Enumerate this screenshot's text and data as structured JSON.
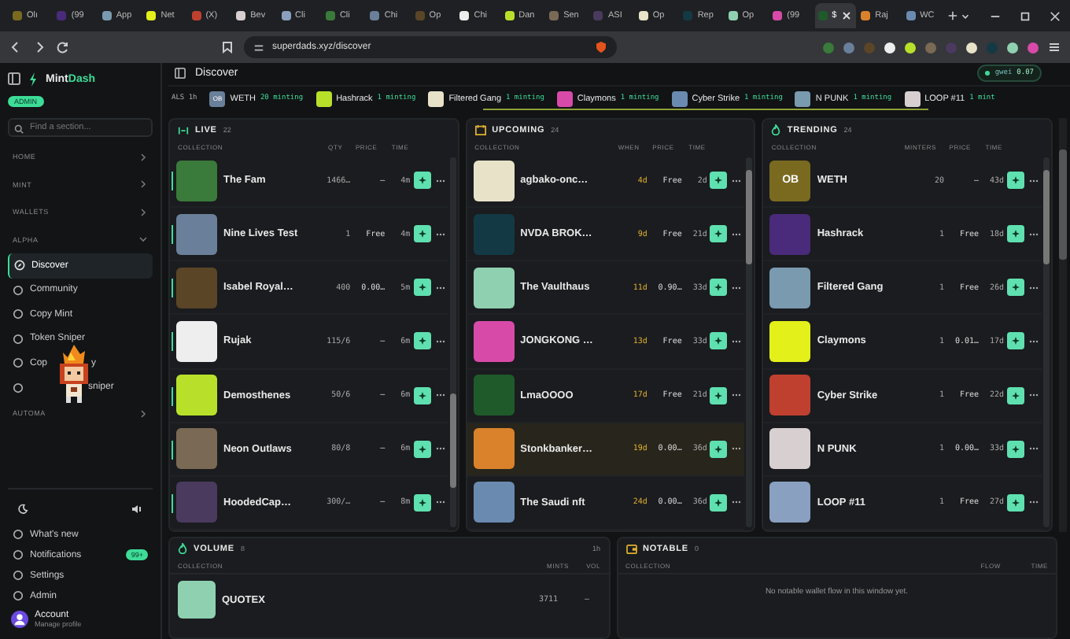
{
  "browser": {
    "tabs": [
      {
        "label": "Olı",
        "selected": false
      },
      {
        "label": "(99",
        "selected": false
      },
      {
        "label": "App",
        "selected": false
      },
      {
        "label": "Net",
        "selected": false
      },
      {
        "label": "(X)",
        "selected": false
      },
      {
        "label": "Bev",
        "selected": false
      },
      {
        "label": "Cli",
        "selected": false
      },
      {
        "label": "Cli",
        "selected": false
      },
      {
        "label": "Chi",
        "selected": false
      },
      {
        "label": "Op",
        "selected": false
      },
      {
        "label": "Chi",
        "selected": false
      },
      {
        "label": "Dan",
        "selected": false
      },
      {
        "label": "Sen",
        "selected": false
      },
      {
        "label": "ASI",
        "selected": false
      },
      {
        "label": "Op",
        "selected": false
      },
      {
        "label": "Rep",
        "selected": false
      },
      {
        "label": "Op",
        "selected": false
      },
      {
        "label": "(99",
        "selected": false
      },
      {
        "label": "$",
        "selected": true
      },
      {
        "label": "Raj",
        "selected": false
      },
      {
        "label": "WC",
        "selected": false
      }
    ],
    "address": "superdads.xyz/discover"
  },
  "sidebar": {
    "brand_start": "Mint",
    "brand_end": "Dash",
    "role_badge": "ADMIN",
    "search": {
      "placeholder": "Find a section..."
    },
    "sections": [
      {
        "label": "HOME",
        "expanded": false
      },
      {
        "label": "MINT",
        "expanded": false
      },
      {
        "label": "WALLETS",
        "expanded": false
      },
      {
        "label": "ALPHA",
        "expanded": true,
        "items": [
          {
            "label": "Discover",
            "selected": true
          },
          {
            "label": "Community",
            "selected": false
          },
          {
            "label": "Copy Mint",
            "selected": false
          },
          {
            "label": "Token Sniper",
            "selected": false
          },
          {
            "label": "Cop",
            "label_end": "y",
            "selected": false
          },
          {
            "label_end": "sniper",
            "selected": false
          }
        ]
      },
      {
        "label": "AUTOMA",
        "expanded": false
      }
    ],
    "footer": [
      {
        "label": "What's new"
      },
      {
        "label": "Notifications",
        "badge": "99+"
      },
      {
        "label": "Settings"
      },
      {
        "label": "Admin"
      }
    ],
    "account": {
      "name": "Account",
      "subtitle": "Manage profile"
    }
  },
  "header": {
    "title": "Discover",
    "gas_label": "gwei",
    "gas_value": "0.07"
  },
  "ticker": {
    "label": "ALS 1h",
    "items": [
      {
        "name": "WETH",
        "count": "20 minting",
        "thumb_text": "OB"
      },
      {
        "name": "Hashrack",
        "count": "1 minting"
      },
      {
        "name": "Filtered Gang",
        "count": "1 minting"
      },
      {
        "name": "Claymons",
        "count": "1 minting"
      },
      {
        "name": "Cyber Strike",
        "count": "1 minting"
      },
      {
        "name": "N PUNK",
        "count": "1 minting"
      },
      {
        "name": "LOOP #11",
        "count": "1 mint"
      }
    ]
  },
  "panels": [
    {
      "kind": "live",
      "title": "LIVE",
      "count": "22",
      "columns": [
        "COLLECTION",
        "QTY",
        "PRICE",
        "TIME"
      ],
      "rows": [
        {
          "name": "The Fam",
          "values": [
            "1466…",
            "—",
            "4m"
          ],
          "selected": false
        },
        {
          "name": "Nine Lives Test",
          "values": [
            "1",
            "Free",
            "4m"
          ],
          "selected": false
        },
        {
          "name": "Isabel Royal…",
          "values": [
            "400",
            "0.00…",
            "5m"
          ],
          "selected": false
        },
        {
          "name": "Rujak",
          "values": [
            "115/6",
            "—",
            "6m"
          ],
          "selected": false
        },
        {
          "name": "Demosthenes",
          "values": [
            "50/6",
            "—",
            "6m"
          ],
          "selected": false
        },
        {
          "name": "Neon Outlaws",
          "values": [
            "80/8",
            "—",
            "6m"
          ],
          "selected": false
        },
        {
          "name": "HoodedCap…",
          "values": [
            "300/…",
            "—",
            "8m"
          ],
          "selected": false
        }
      ]
    },
    {
      "kind": "upcoming",
      "title": "UPCOMING",
      "count": "24",
      "columns": [
        "COLLECTION",
        "WHEN",
        "PRICE",
        "TIME"
      ],
      "rows": [
        {
          "name": "agbako-onc…",
          "values": [
            "4d",
            "Free",
            "2d"
          ],
          "selected": false
        },
        {
          "name": "NVDA BROK…",
          "values": [
            "9d",
            "Free",
            "21d"
          ],
          "selected": false
        },
        {
          "name": "The Vaulthaus",
          "values": [
            "11d",
            "0.90…",
            "33d"
          ],
          "selected": false
        },
        {
          "name": "JONGKONG …",
          "values": [
            "13d",
            "Free",
            "33d"
          ],
          "selected": false
        },
        {
          "name": "LmaOOOO",
          "values": [
            "17d",
            "Free",
            "21d"
          ],
          "selected": false
        },
        {
          "name": "Stonkbanker…",
          "values": [
            "19d",
            "0.00…",
            "36d"
          ],
          "selected": true
        },
        {
          "name": "The Saudi nft",
          "values": [
            "24d",
            "0.00…",
            "36d"
          ],
          "selected": false
        }
      ]
    },
    {
      "kind": "trending",
      "title": "TRENDING",
      "count": "24",
      "columns": [
        "COLLECTION",
        "MINTERS",
        "PRICE",
        "TIME"
      ],
      "rows": [
        {
          "name": "WETH",
          "values": [
            "20",
            "—",
            "43d"
          ],
          "selected": false,
          "thumb_text": "OB"
        },
        {
          "name": "Hashrack",
          "values": [
            "1",
            "Free",
            "18d"
          ],
          "selected": false
        },
        {
          "name": "Filtered Gang",
          "values": [
            "1",
            "Free",
            "26d"
          ],
          "selected": false
        },
        {
          "name": "Claymons",
          "values": [
            "1",
            "0.01…",
            "17d"
          ],
          "selected": false
        },
        {
          "name": "Cyber Strike",
          "values": [
            "1",
            "Free",
            "22d"
          ],
          "selected": false
        },
        {
          "name": "N PUNK",
          "values": [
            "1",
            "0.00…",
            "33d"
          ],
          "selected": false
        },
        {
          "name": "LOOP #11",
          "values": [
            "1",
            "Free",
            "27d"
          ],
          "selected": false
        }
      ]
    }
  ],
  "volume": {
    "title": "VOLUME",
    "count": "8",
    "window": "1h",
    "columns": [
      "COLLECTION",
      "MINTS",
      "VOL"
    ],
    "rows": [
      {
        "name": "QUOTEX",
        "values": [
          "3711",
          "—"
        ]
      }
    ]
  },
  "notable": {
    "title": "NOTABLE",
    "count": "0",
    "columns": [
      "COLLECTION",
      "FLOW",
      "TIME"
    ],
    "empty": "No notable wallet flow in this window yet."
  }
}
